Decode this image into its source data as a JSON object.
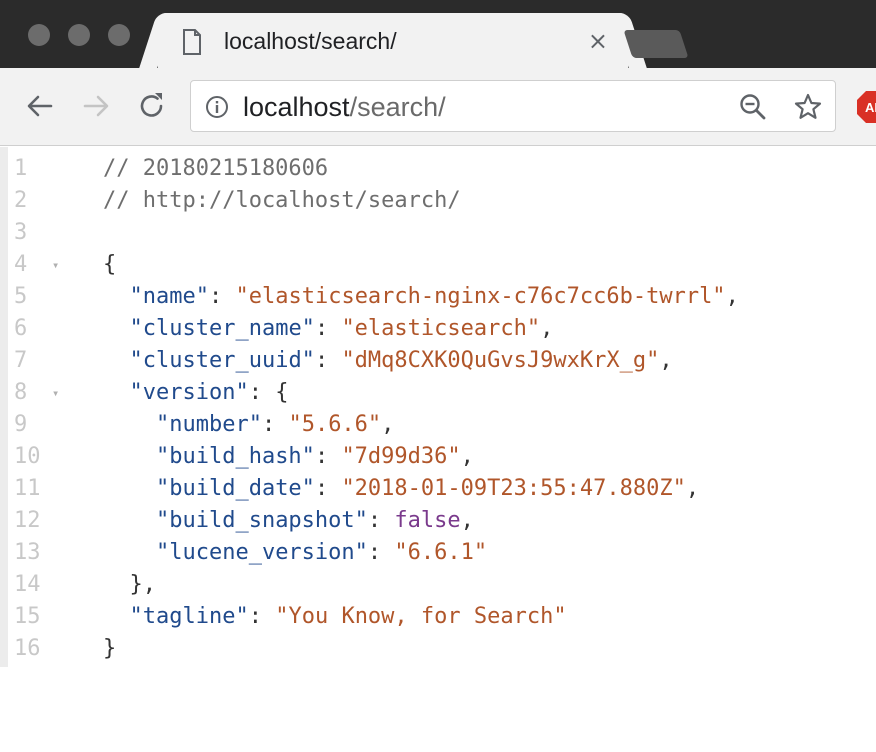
{
  "tab": {
    "title": "localhost/search/",
    "close_glyph": "×"
  },
  "omnibox": {
    "host": "localhost",
    "path": "/search/"
  },
  "extension_badge": "AB",
  "code_lines": [
    {
      "n": "1",
      "fold": "",
      "parts": [
        {
          "t": "// 20180215180606",
          "c": "comment"
        }
      ]
    },
    {
      "n": "2",
      "fold": "",
      "parts": [
        {
          "t": "// http://localhost/search/",
          "c": "comment"
        }
      ]
    },
    {
      "n": "3",
      "fold": "",
      "parts": []
    },
    {
      "n": "4",
      "fold": "▾",
      "parts": [
        {
          "t": "{",
          "c": "punc"
        }
      ]
    },
    {
      "n": "5",
      "fold": "",
      "parts": [
        {
          "t": "  ",
          "c": "punc"
        },
        {
          "t": "\"name\"",
          "c": "key"
        },
        {
          "t": ": ",
          "c": "punc"
        },
        {
          "t": "\"elasticsearch-nginx-c76c7cc6b-twrrl\"",
          "c": "str"
        },
        {
          "t": ",",
          "c": "punc"
        }
      ]
    },
    {
      "n": "6",
      "fold": "",
      "parts": [
        {
          "t": "  ",
          "c": "punc"
        },
        {
          "t": "\"cluster_name\"",
          "c": "key"
        },
        {
          "t": ": ",
          "c": "punc"
        },
        {
          "t": "\"elasticsearch\"",
          "c": "str"
        },
        {
          "t": ",",
          "c": "punc"
        }
      ]
    },
    {
      "n": "7",
      "fold": "",
      "parts": [
        {
          "t": "  ",
          "c": "punc"
        },
        {
          "t": "\"cluster_uuid\"",
          "c": "key"
        },
        {
          "t": ": ",
          "c": "punc"
        },
        {
          "t": "\"dMq8CXK0QuGvsJ9wxKrX_g\"",
          "c": "str"
        },
        {
          "t": ",",
          "c": "punc"
        }
      ]
    },
    {
      "n": "8",
      "fold": "▾",
      "parts": [
        {
          "t": "  ",
          "c": "punc"
        },
        {
          "t": "\"version\"",
          "c": "key"
        },
        {
          "t": ": {",
          "c": "punc"
        }
      ]
    },
    {
      "n": "9",
      "fold": "",
      "parts": [
        {
          "t": "    ",
          "c": "punc"
        },
        {
          "t": "\"number\"",
          "c": "key"
        },
        {
          "t": ": ",
          "c": "punc"
        },
        {
          "t": "\"5.6.6\"",
          "c": "str"
        },
        {
          "t": ",",
          "c": "punc"
        }
      ]
    },
    {
      "n": "10",
      "fold": "",
      "parts": [
        {
          "t": "    ",
          "c": "punc"
        },
        {
          "t": "\"build_hash\"",
          "c": "key"
        },
        {
          "t": ": ",
          "c": "punc"
        },
        {
          "t": "\"7d99d36\"",
          "c": "str"
        },
        {
          "t": ",",
          "c": "punc"
        }
      ]
    },
    {
      "n": "11",
      "fold": "",
      "parts": [
        {
          "t": "    ",
          "c": "punc"
        },
        {
          "t": "\"build_date\"",
          "c": "key"
        },
        {
          "t": ": ",
          "c": "punc"
        },
        {
          "t": "\"2018-01-09T23:55:47.880Z\"",
          "c": "str"
        },
        {
          "t": ",",
          "c": "punc"
        }
      ]
    },
    {
      "n": "12",
      "fold": "",
      "parts": [
        {
          "t": "    ",
          "c": "punc"
        },
        {
          "t": "\"build_snapshot\"",
          "c": "key"
        },
        {
          "t": ": ",
          "c": "punc"
        },
        {
          "t": "false",
          "c": "bool"
        },
        {
          "t": ",",
          "c": "punc"
        }
      ]
    },
    {
      "n": "13",
      "fold": "",
      "parts": [
        {
          "t": "    ",
          "c": "punc"
        },
        {
          "t": "\"lucene_version\"",
          "c": "key"
        },
        {
          "t": ": ",
          "c": "punc"
        },
        {
          "t": "\"6.6.1\"",
          "c": "str"
        }
      ]
    },
    {
      "n": "14",
      "fold": "",
      "parts": [
        {
          "t": "  },",
          "c": "punc"
        }
      ]
    },
    {
      "n": "15",
      "fold": "",
      "parts": [
        {
          "t": "  ",
          "c": "punc"
        },
        {
          "t": "\"tagline\"",
          "c": "key"
        },
        {
          "t": ": ",
          "c": "punc"
        },
        {
          "t": "\"You Know, for Search\"",
          "c": "str"
        }
      ]
    },
    {
      "n": "16",
      "fold": "",
      "parts": [
        {
          "t": "}",
          "c": "punc"
        }
      ]
    }
  ]
}
